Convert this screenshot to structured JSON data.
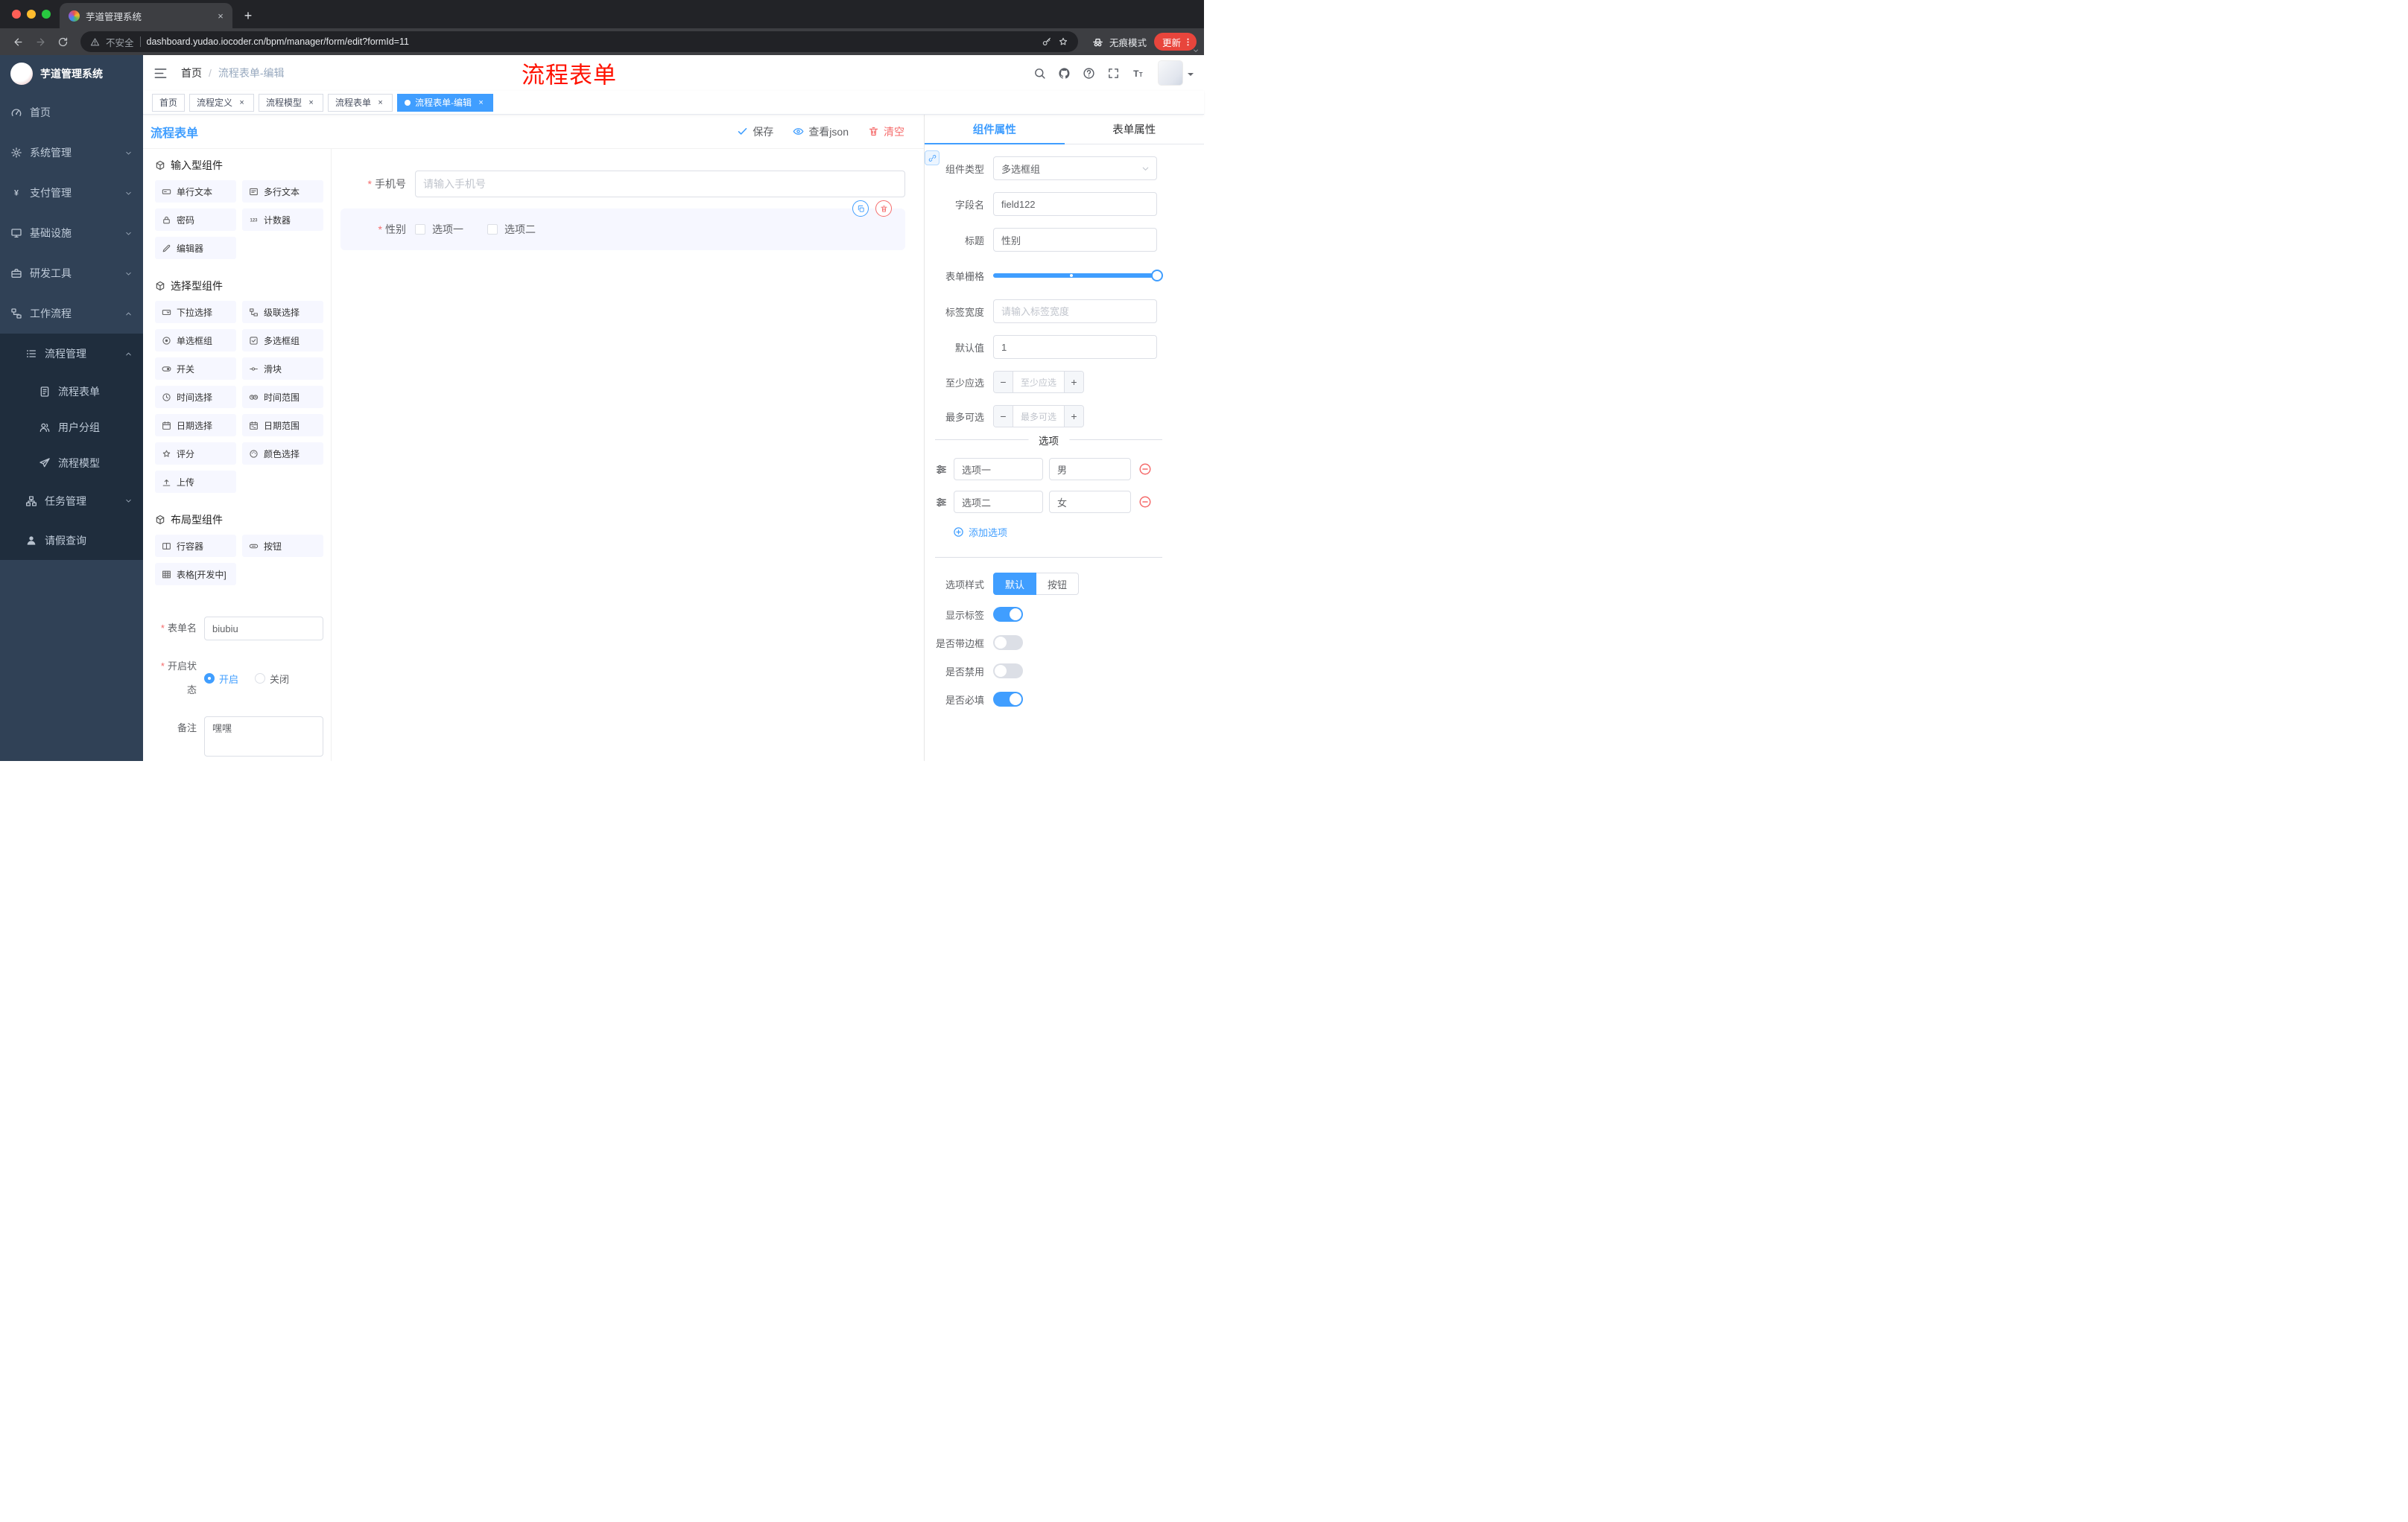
{
  "colors": {
    "primary": "#409eff",
    "danger": "#f56c6c",
    "update_badge": "#e8453c"
  },
  "annotation": {
    "text": "流程表单",
    "color": "#ff1200"
  },
  "browser": {
    "tab_title": "芋道管理系统",
    "security_label": "不安全",
    "url": "dashboard.yudao.iocoder.cn/bpm/manager/form/edit?formId=11",
    "incognito_label": "无痕模式",
    "update_label": "更新"
  },
  "sidebar": {
    "logo_title": "芋道管理系统",
    "items": [
      {
        "label": "首页"
      },
      {
        "label": "系统管理"
      },
      {
        "label": "支付管理"
      },
      {
        "label": "基础设施"
      },
      {
        "label": "研发工具"
      },
      {
        "label": "工作流程"
      },
      {
        "label": "流程管理"
      },
      {
        "label": "流程表单"
      },
      {
        "label": "用户分组"
      },
      {
        "label": "流程模型"
      },
      {
        "label": "任务管理"
      },
      {
        "label": "请假查询"
      }
    ]
  },
  "navbar": {
    "breadcrumb_home": "首页",
    "breadcrumb_current": "流程表单-编辑"
  },
  "tags": [
    {
      "label": "首页"
    },
    {
      "label": "流程定义"
    },
    {
      "label": "流程模型"
    },
    {
      "label": "流程表单"
    },
    {
      "label": "流程表单-编辑"
    }
  ],
  "designer": {
    "title": "流程表单",
    "save": "保存",
    "view_json": "查看json",
    "clear": "清空",
    "groups": [
      {
        "title": "输入型组件",
        "items": [
          "单行文本",
          "多行文本",
          "密码",
          "计数器",
          "编辑器"
        ]
      },
      {
        "title": "选择型组件",
        "items": [
          "下拉选择",
          "级联选择",
          "单选框组",
          "多选框组",
          "开关",
          "滑块",
          "时间选择",
          "时间范围",
          "日期选择",
          "日期范围",
          "评分",
          "颜色选择",
          "上传"
        ]
      },
      {
        "title": "布局型组件",
        "items": [
          "行容器",
          "按钮",
          "表格[开发中]"
        ]
      }
    ],
    "meta": {
      "form_name_label": "表单名",
      "form_name_value": "biubiu",
      "status_label": "开启状态",
      "status_on": "开启",
      "status_off": "关闭",
      "remark_label": "备注",
      "remark_value": "嘿嘿"
    },
    "canvas": {
      "phone_label": "手机号",
      "phone_placeholder": "请输入手机号",
      "gender_label": "性别",
      "gender_opt1": "选项一",
      "gender_opt2": "选项二"
    }
  },
  "props": {
    "tab_component": "组件属性",
    "tab_form": "表单属性",
    "rows": {
      "type_label": "组件类型",
      "type_value": "多选框组",
      "field_label": "字段名",
      "field_value": "field122",
      "title_label": "标题",
      "title_value": "性别",
      "grid_label": "表单栅格",
      "width_label": "标签宽度",
      "width_placeholder": "请输入标签宽度",
      "default_label": "默认值",
      "default_value": "1",
      "min_label": "至少应选",
      "min_placeholder": "至少应选",
      "max_label": "最多可选",
      "max_placeholder": "最多可选"
    },
    "options": {
      "divider": "选项",
      "items": [
        {
          "label": "选项一",
          "value": "男"
        },
        {
          "label": "选项二",
          "value": "女"
        }
      ],
      "add": "添加选项"
    },
    "style": {
      "label": "选项样式",
      "default": "默认",
      "button": "按钮"
    },
    "switches": {
      "show_label": "显示标签",
      "border": "是否带边框",
      "disabled": "是否禁用",
      "required": "是否必填"
    }
  }
}
